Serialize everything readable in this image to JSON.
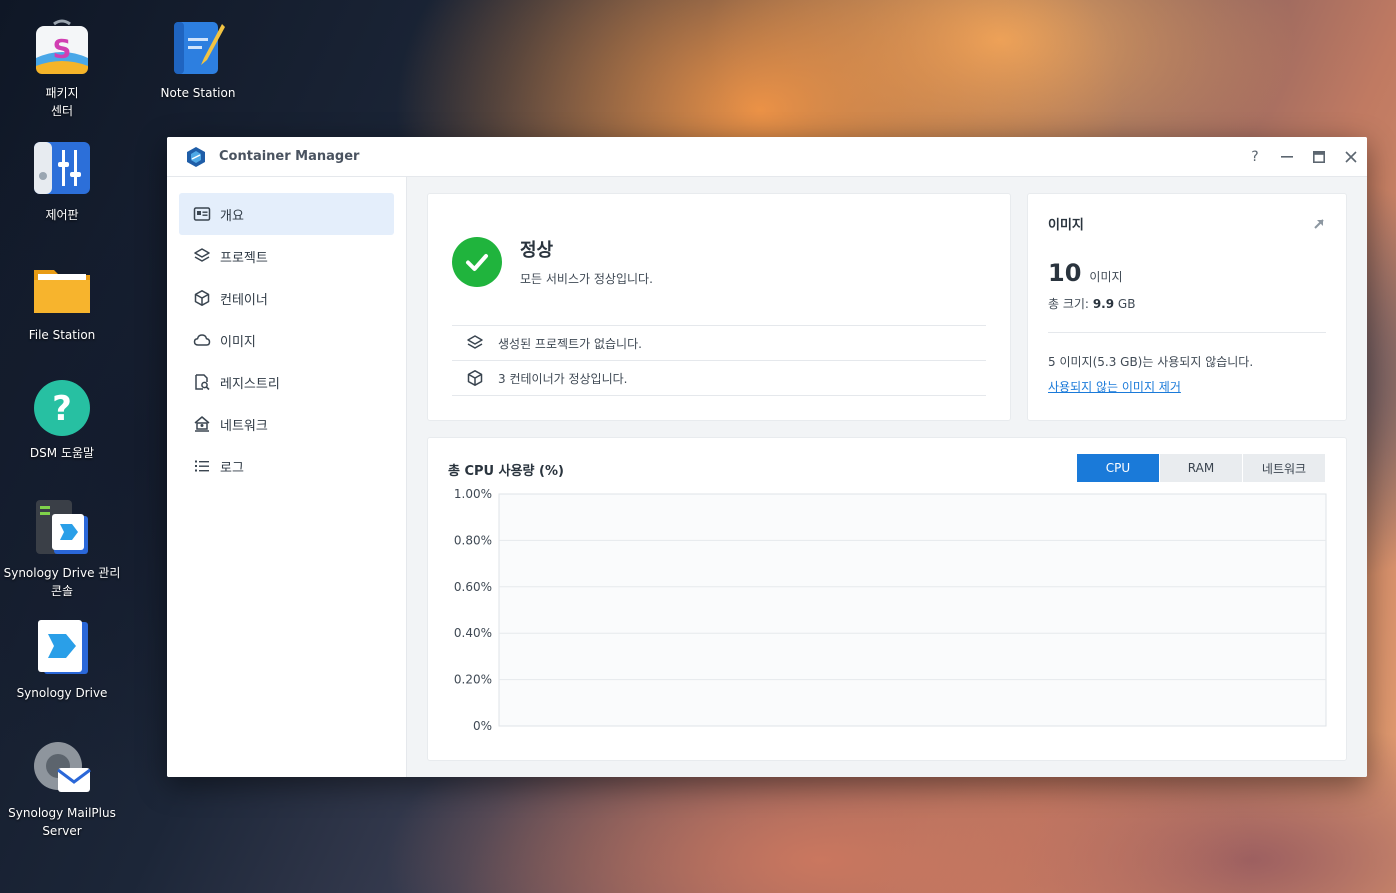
{
  "desktop": {
    "icons": [
      {
        "label": "패키지\n센터",
        "icon": "package-center-icon"
      },
      {
        "label": "Note Station",
        "icon": "note-station-icon"
      },
      {
        "label": "제어판",
        "icon": "control-panel-icon"
      },
      {
        "label": "File Station",
        "icon": "file-station-icon"
      },
      {
        "label": "DSM 도움말",
        "icon": "help-icon"
      },
      {
        "label": "Synology Drive 관리\n콘솔",
        "icon": "drive-admin-icon"
      },
      {
        "label": "Synology Drive",
        "icon": "drive-icon"
      },
      {
        "label": "Synology MailPlus\nServer",
        "icon": "mailplus-icon"
      }
    ]
  },
  "window": {
    "title": "Container Manager",
    "controls": {
      "help": "?",
      "minimize": "—",
      "maximize": "▭",
      "close": "✕"
    }
  },
  "sidebar": {
    "items": [
      {
        "label": "개요",
        "icon": "overview-icon",
        "active": true
      },
      {
        "label": "프로젝트",
        "icon": "layers-icon",
        "active": false
      },
      {
        "label": "컨테이너",
        "icon": "cube-icon",
        "active": false
      },
      {
        "label": "이미지",
        "icon": "cloud-icon",
        "active": false
      },
      {
        "label": "레지스트리",
        "icon": "registry-search-icon",
        "active": false
      },
      {
        "label": "네트워크",
        "icon": "network-icon",
        "active": false
      },
      {
        "label": "로그",
        "icon": "list-icon",
        "active": false
      }
    ]
  },
  "status": {
    "title": "정상",
    "subtitle": "모든 서비스가 정상입니다.",
    "rows": [
      {
        "text": "생성된 프로젝트가 없습니다.",
        "icon": "layers-icon"
      },
      {
        "text": "3 컨테이너가 정상입니다.",
        "icon": "cube-icon"
      }
    ]
  },
  "images": {
    "title": "이미지",
    "count": "10",
    "count_unit": "이미지",
    "size_label": "총 크기:",
    "size_value": "9.9",
    "size_unit": "GB",
    "unused_text": "5 이미지(5.3 GB)는 사용되지 않습니다.",
    "remove_link": "사용되지 않는 이미지 제거"
  },
  "chart": {
    "title": "총 CPU 사용량 (%)",
    "tabs": [
      "CPU",
      "RAM",
      "네트워크"
    ],
    "active_tab": 0,
    "accent": "#1a7ad9"
  },
  "chart_data": {
    "type": "line",
    "title": "총 CPU 사용량 (%)",
    "yticks": [
      "1.00%",
      "0.80%",
      "0.60%",
      "0.40%",
      "0.20%",
      "0%"
    ],
    "ylim": [
      0,
      1.0
    ],
    "series": [],
    "grid": true
  }
}
